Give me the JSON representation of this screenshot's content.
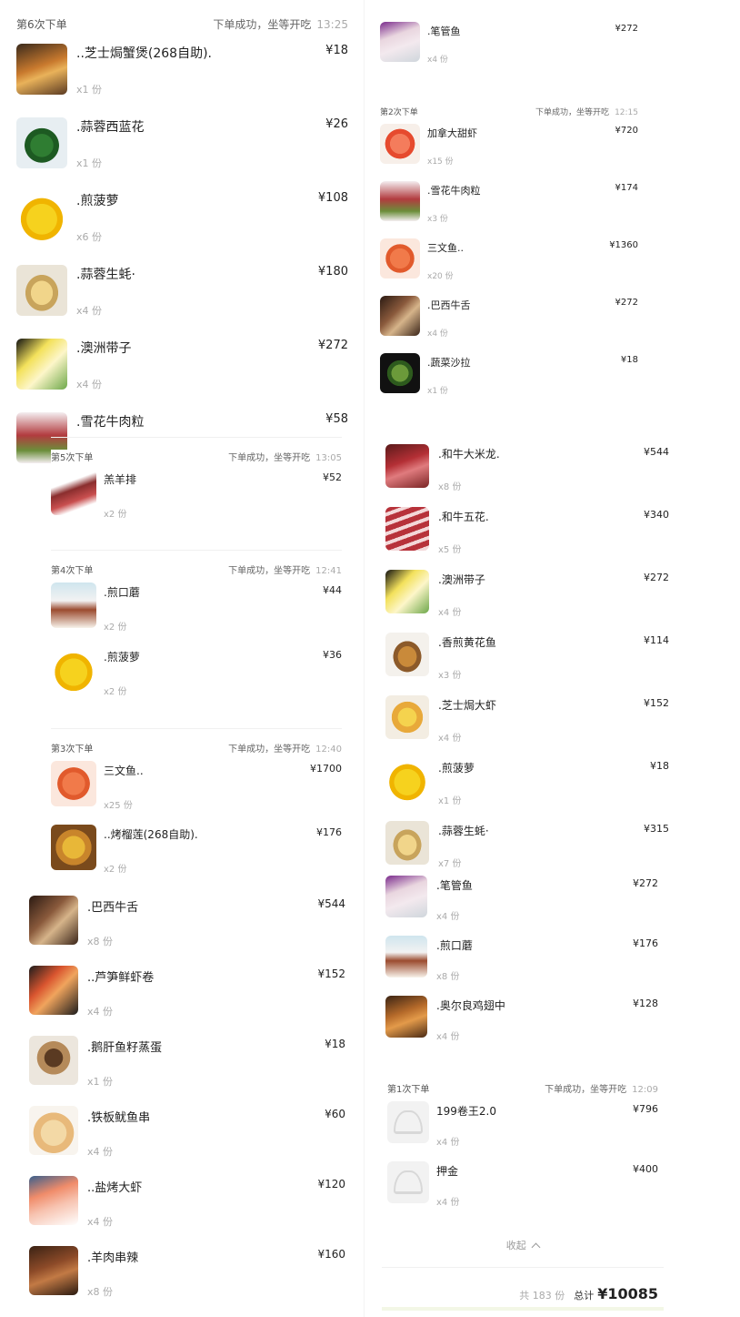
{
  "colors": {
    "accent": "#e8a33d",
    "text": "#222222",
    "muted": "#aaaaaa",
    "placeholder": "#f2f2f2"
  },
  "order6": {
    "title": "第6次下单",
    "status": "下单成功，坐等开吃",
    "time": "13:25",
    "items": [
      {
        "name": "..芝士焗蟹煲(268自助).",
        "price": "¥18",
        "qty": "x1 份",
        "icon": "crab-cheese-dish"
      },
      {
        "name": ".蒜蓉西蓝花",
        "price": "¥26",
        "qty": "x1 份",
        "icon": "broccoli-dish"
      },
      {
        "name": ".煎菠萝",
        "price": "¥108",
        "qty": "x6 份",
        "icon": "pineapple-dish"
      },
      {
        "name": ".蒜蓉生蚝·",
        "price": "¥180",
        "qty": "x4 份",
        "icon": "oyster-dish"
      },
      {
        "name": ".澳洲带子",
        "price": "¥272",
        "qty": "x4 份",
        "icon": "scallop-dish"
      },
      {
        "name": ".雪花牛肉粒",
        "price": "¥58",
        "qty": "",
        "icon": "beef-cube-dish"
      }
    ]
  },
  "order5": {
    "title": "第5次下单",
    "status": "下单成功，坐等开吃",
    "time": "13:05",
    "items": [
      {
        "name": "羔羊排",
        "price": "¥52",
        "qty": "x2 份",
        "icon": "lamb-chop-dish"
      }
    ]
  },
  "order4": {
    "title": "第4次下单",
    "status": "下单成功，坐等开吃",
    "time": "12:41",
    "items": [
      {
        "name": ".煎口蘑",
        "price": "¥44",
        "qty": "x2 份",
        "icon": "mushroom-dish"
      },
      {
        "name": ".煎菠萝",
        "price": "¥36",
        "qty": "x2 份",
        "icon": "pineapple-dish"
      }
    ]
  },
  "order3": {
    "title": "第3次下单",
    "status": "下单成功，坐等开吃",
    "time": "12:40",
    "items": [
      {
        "name": "三文鱼..",
        "price": "¥1700",
        "qty": "x25 份",
        "icon": "salmon-dish"
      },
      {
        "name": "..烤榴莲(268自助).",
        "price": "¥176",
        "qty": "x2 份",
        "icon": "durian-dish"
      }
    ]
  },
  "left_bottom": {
    "items": [
      {
        "name": ".巴西牛舌",
        "price": "¥544",
        "qty": "x8 份",
        "icon": "beef-tongue-dish"
      },
      {
        "name": "..芦笋鲜虾卷",
        "price": "¥152",
        "qty": "x4 份",
        "icon": "shrimp-roll-dish"
      },
      {
        "name": ".鹅肝鱼籽蒸蛋",
        "price": "¥18",
        "qty": "x1 份",
        "icon": "steamed-egg-dish"
      },
      {
        "name": ".铁板鱿鱼串",
        "price": "¥60",
        "qty": "x4 份",
        "icon": "squid-skewer-dish"
      },
      {
        "name": "..盐烤大虾",
        "price": "¥120",
        "qty": "x4 份",
        "icon": "grilled-shrimp-dish"
      },
      {
        "name": ".羊肉串辣",
        "price": "¥160",
        "qty": "x8 份",
        "icon": "lamb-skewer-dish"
      }
    ]
  },
  "right_top": {
    "items": [
      {
        "name": ".笔管鱼",
        "price": "¥272",
        "qty": "x4 份",
        "icon": "squid-dish"
      }
    ]
  },
  "order2": {
    "title": "第2次下单",
    "status": "下单成功，坐等开吃",
    "time": "12:15",
    "items": [
      {
        "name": "加拿大甜虾",
        "price": "¥720",
        "qty": "x15 份",
        "icon": "sweet-shrimp-dish"
      },
      {
        "name": ".雪花牛肉粒",
        "price": "¥174",
        "qty": "x3 份",
        "icon": "beef-cube-dish"
      },
      {
        "name": "三文鱼..",
        "price": "¥1360",
        "qty": "x20 份",
        "icon": "salmon-dish"
      },
      {
        "name": ".巴西牛舌",
        "price": "¥272",
        "qty": "x4 份",
        "icon": "beef-tongue-dish"
      },
      {
        "name": ".蔬菜沙拉",
        "price": "¥18",
        "qty": "x1 份",
        "icon": "salad-dish"
      }
    ]
  },
  "right_mid": {
    "items": [
      {
        "name": ".和牛大米龙.",
        "price": "¥544",
        "qty": "x8 份",
        "icon": "wagyu-dish"
      },
      {
        "name": ".和牛五花.",
        "price": "¥340",
        "qty": "x5 份",
        "icon": "wagyu-belly-dish"
      },
      {
        "name": ".澳洲带子",
        "price": "¥272",
        "qty": "x4 份",
        "icon": "scallop-dish"
      },
      {
        "name": ".香煎黄花鱼",
        "price": "¥114",
        "qty": "x3 份",
        "icon": "fried-fish-dish"
      },
      {
        "name": ".芝士焗大虾",
        "price": "¥152",
        "qty": "x4 份",
        "icon": "cheese-shrimp-dish"
      },
      {
        "name": ".煎菠萝",
        "price": "¥18",
        "qty": "x1 份",
        "icon": "pineapple-dish"
      },
      {
        "name": ".蒜蓉生蚝·",
        "price": "¥315",
        "qty": "x7 份",
        "icon": "oyster-dish"
      }
    ]
  },
  "right_lower": {
    "items": [
      {
        "name": ".笔管鱼",
        "price": "¥272",
        "qty": "x4 份",
        "icon": "squid-dish"
      },
      {
        "name": ".煎口蘑",
        "price": "¥176",
        "qty": "x8 份",
        "icon": "mushroom-dish"
      },
      {
        "name": ".奥尔良鸡翅中",
        "price": "¥128",
        "qty": "x4 份",
        "icon": "chicken-wing-dish"
      }
    ]
  },
  "order1": {
    "title": "第1次下单",
    "status": "下单成功，坐等开吃",
    "time": "12:09",
    "items": [
      {
        "name": "199卷王2.0",
        "price": "¥796",
        "qty": "x4 份",
        "icon": "placeholder-dish"
      },
      {
        "name": "押金",
        "price": "¥400",
        "qty": "x4 份",
        "icon": "placeholder-dish"
      }
    ]
  },
  "footer": {
    "collapse_label": "收起",
    "count_label": "共 183 份",
    "total_label": "总计",
    "total_value": "¥10085"
  }
}
